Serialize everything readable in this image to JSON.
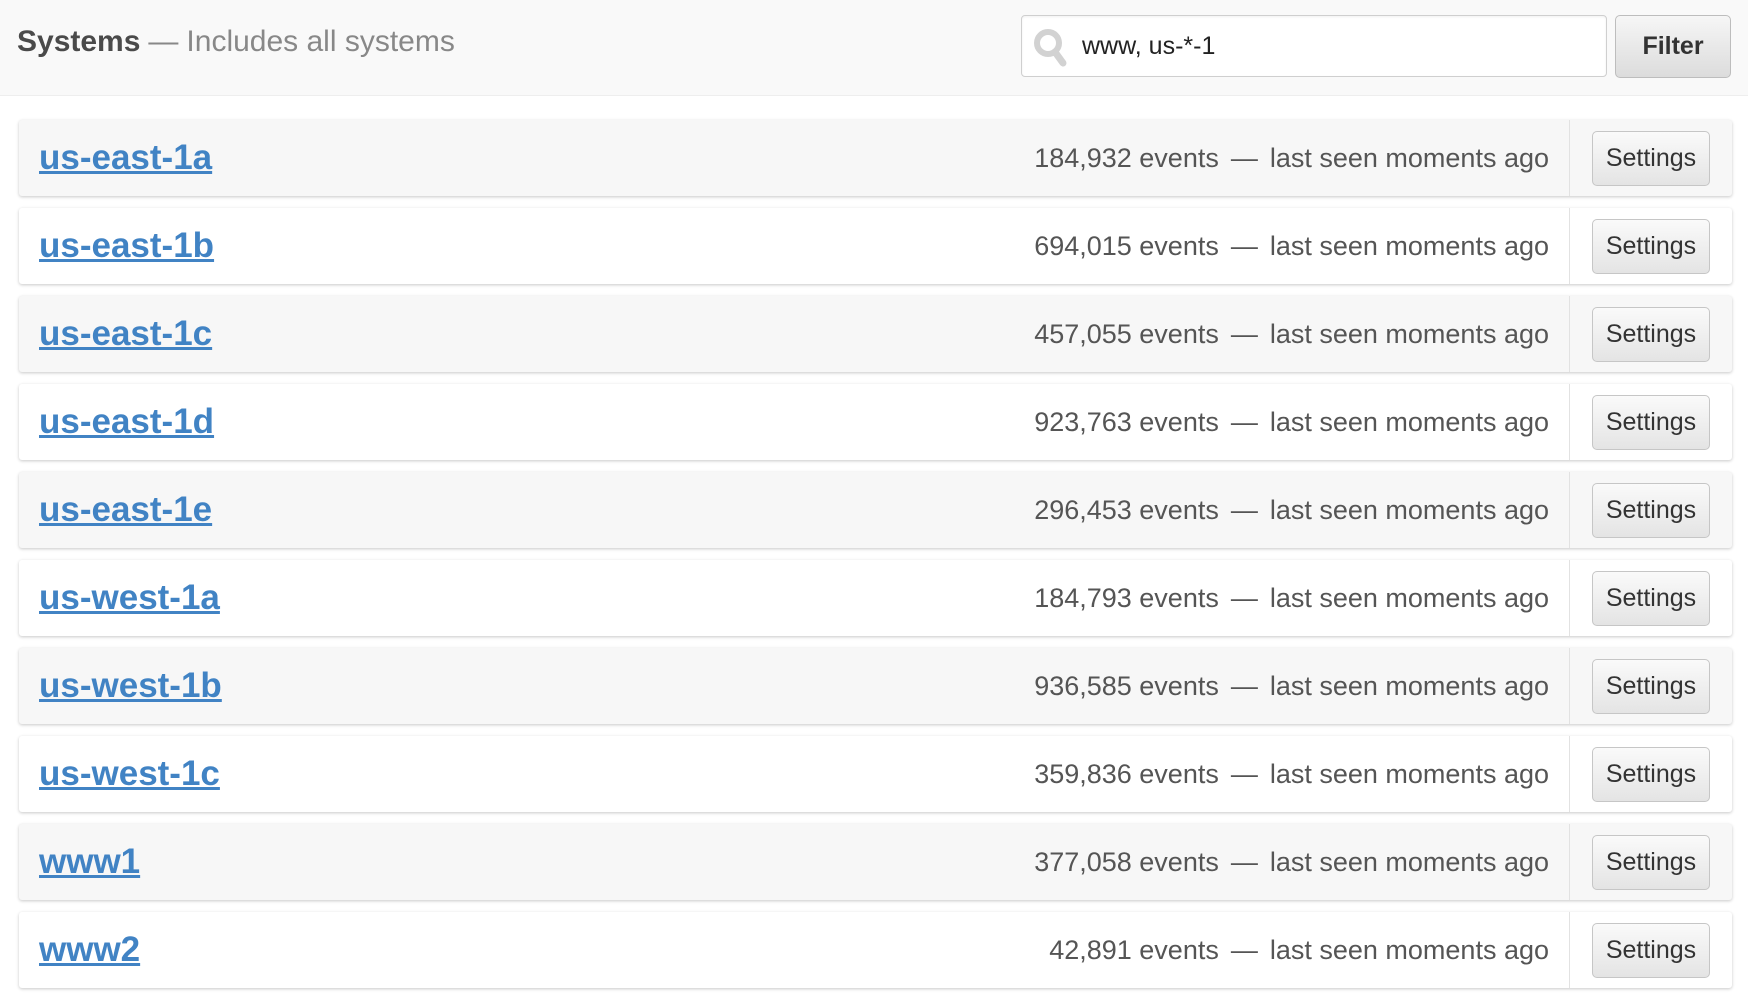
{
  "header": {
    "title": "Systems",
    "separator": "—",
    "subtitle": "Includes all systems"
  },
  "search": {
    "icon": "search-icon",
    "value": "www, us-*-1",
    "filter_label": "Filter"
  },
  "colors": {
    "link": "#4183c4",
    "row_shaded": "#f7f7f7",
    "header_bg": "#f9f9f9"
  },
  "systems": [
    {
      "name": "us-east-1a",
      "events": "184,932 events",
      "separator": "—",
      "last_seen": "last seen moments ago",
      "action": "Settings"
    },
    {
      "name": "us-east-1b",
      "events": "694,015 events",
      "separator": "—",
      "last_seen": "last seen moments ago",
      "action": "Settings"
    },
    {
      "name": "us-east-1c",
      "events": "457,055 events",
      "separator": "—",
      "last_seen": "last seen moments ago",
      "action": "Settings"
    },
    {
      "name": "us-east-1d",
      "events": "923,763 events",
      "separator": "—",
      "last_seen": "last seen moments ago",
      "action": "Settings"
    },
    {
      "name": "us-east-1e",
      "events": "296,453 events",
      "separator": "—",
      "last_seen": "last seen moments ago",
      "action": "Settings"
    },
    {
      "name": "us-west-1a",
      "events": "184,793 events",
      "separator": "—",
      "last_seen": "last seen moments ago",
      "action": "Settings"
    },
    {
      "name": "us-west-1b",
      "events": "936,585 events",
      "separator": "—",
      "last_seen": "last seen moments ago",
      "action": "Settings"
    },
    {
      "name": "us-west-1c",
      "events": "359,836 events",
      "separator": "—",
      "last_seen": "last seen moments ago",
      "action": "Settings"
    },
    {
      "name": "www1",
      "events": "377,058 events",
      "separator": "—",
      "last_seen": "last seen moments ago",
      "action": "Settings"
    },
    {
      "name": "www2",
      "events": "42,891 events",
      "separator": "—",
      "last_seen": "last seen moments ago",
      "action": "Settings"
    }
  ]
}
